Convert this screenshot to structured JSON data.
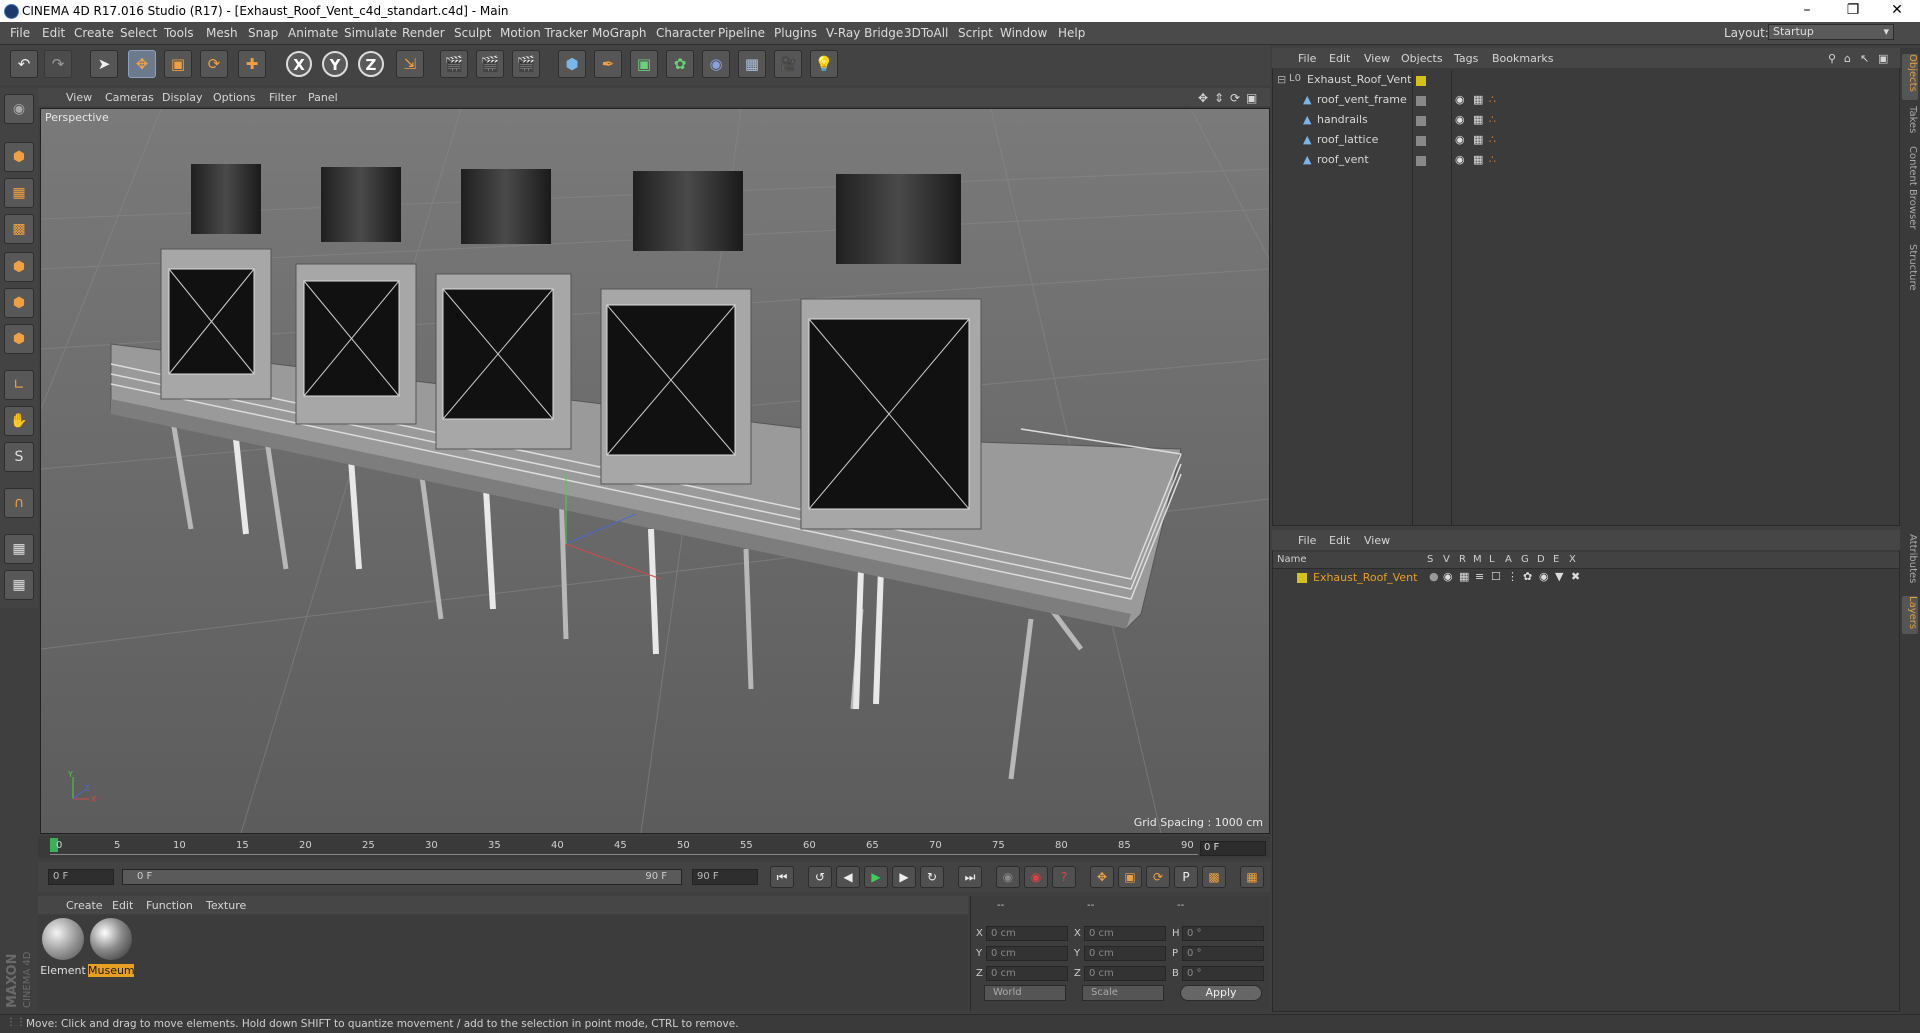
{
  "window": {
    "title": "CINEMA 4D R17.016 Studio (R17) - [Exhaust_Roof_Vent_c4d_standart.c4d] - Main",
    "controls": [
      "minimize-icon",
      "maximize-icon",
      "close-icon"
    ]
  },
  "menu": [
    "File",
    "Edit",
    "Create",
    "Select",
    "Tools",
    "Mesh",
    "Snap",
    "Animate",
    "Simulate",
    "Render",
    "Sculpt",
    "Motion Tracker",
    "MoGraph",
    "Character",
    "Pipeline",
    "Plugins",
    "V-Ray Bridge",
    "3DToAll",
    "Script",
    "Window",
    "Help"
  ],
  "layout": {
    "label": "Layout:",
    "value": "Startup"
  },
  "toolbar": {
    "axis_x": "X",
    "axis_y": "Y",
    "axis_z": "Z"
  },
  "viewport": {
    "menu": [
      "View",
      "Cameras",
      "Display",
      "Options",
      "Filter",
      "Panel"
    ],
    "camera": "Perspective",
    "grid_spacing": "Grid Spacing : 1000 cm",
    "axis_labels": {
      "x": "X",
      "y": "Y",
      "z": "Z"
    }
  },
  "timeline": {
    "ticks": [
      "0",
      "5",
      "10",
      "15",
      "20",
      "25",
      "30",
      "35",
      "40",
      "45",
      "50",
      "55",
      "60",
      "65",
      "70",
      "75",
      "80",
      "85",
      "90"
    ],
    "current_frame": "0 F",
    "start": "0 F",
    "range_start": "0 F",
    "range_end": "90 F",
    "end": "90 F"
  },
  "materials": {
    "menu": [
      "Create",
      "Edit",
      "Function",
      "Texture"
    ],
    "items": [
      {
        "name": "Element",
        "selected": false
      },
      {
        "name": "Museum",
        "selected": true
      }
    ]
  },
  "coordinates": {
    "rows": [
      {
        "a": "X",
        "a_val": "0 cm",
        "b": "X",
        "b_val": "0 cm",
        "c": "H",
        "c_val": "0 °"
      },
      {
        "a": "Y",
        "a_val": "0 cm",
        "b": "Y",
        "b_val": "0 cm",
        "c": "P",
        "c_val": "0 °"
      },
      {
        "a": "Z",
        "a_val": "0 cm",
        "b": "Z",
        "b_val": "0 cm",
        "c": "B",
        "c_val": "0 °"
      }
    ],
    "header_dashes": [
      "--",
      "--",
      "--"
    ],
    "mode": "World",
    "scale": "Scale",
    "apply": "Apply"
  },
  "objects": {
    "menu": [
      "File",
      "Edit",
      "View",
      "Objects",
      "Tags",
      "Bookmarks"
    ],
    "tree": [
      {
        "name": "Exhaust_Roof_Vent",
        "level": 0,
        "kind": "null"
      },
      {
        "name": "roof_vent_frame",
        "level": 1,
        "kind": "mesh"
      },
      {
        "name": "handrails",
        "level": 1,
        "kind": "mesh"
      },
      {
        "name": "roof_lattice",
        "level": 1,
        "kind": "mesh"
      },
      {
        "name": "roof_vent",
        "level": 1,
        "kind": "mesh"
      }
    ]
  },
  "layers": {
    "menu": [
      "File",
      "Edit",
      "View"
    ],
    "columns": [
      "Name",
      "S",
      "V",
      "R",
      "M",
      "L",
      "A",
      "G",
      "D",
      "E",
      "X"
    ],
    "rows": [
      {
        "name": "Exhaust_Roof_Vent",
        "color": "#d4c21a"
      }
    ]
  },
  "side_tabs": [
    "Objects",
    "Takes",
    "Content Browser",
    "Structure",
    "Attributes",
    "Layers"
  ],
  "status": "Move: Click and drag to move elements. Hold down SHIFT to quantize movement / add to the selection in point mode, CTRL to remove.",
  "brand": {
    "line1": "MAXON",
    "line2": "CINEMA 4D"
  },
  "colors": {
    "accent": "#e0a040",
    "layer_yellow": "#d4c21a",
    "selected_label": "#e8a020"
  }
}
